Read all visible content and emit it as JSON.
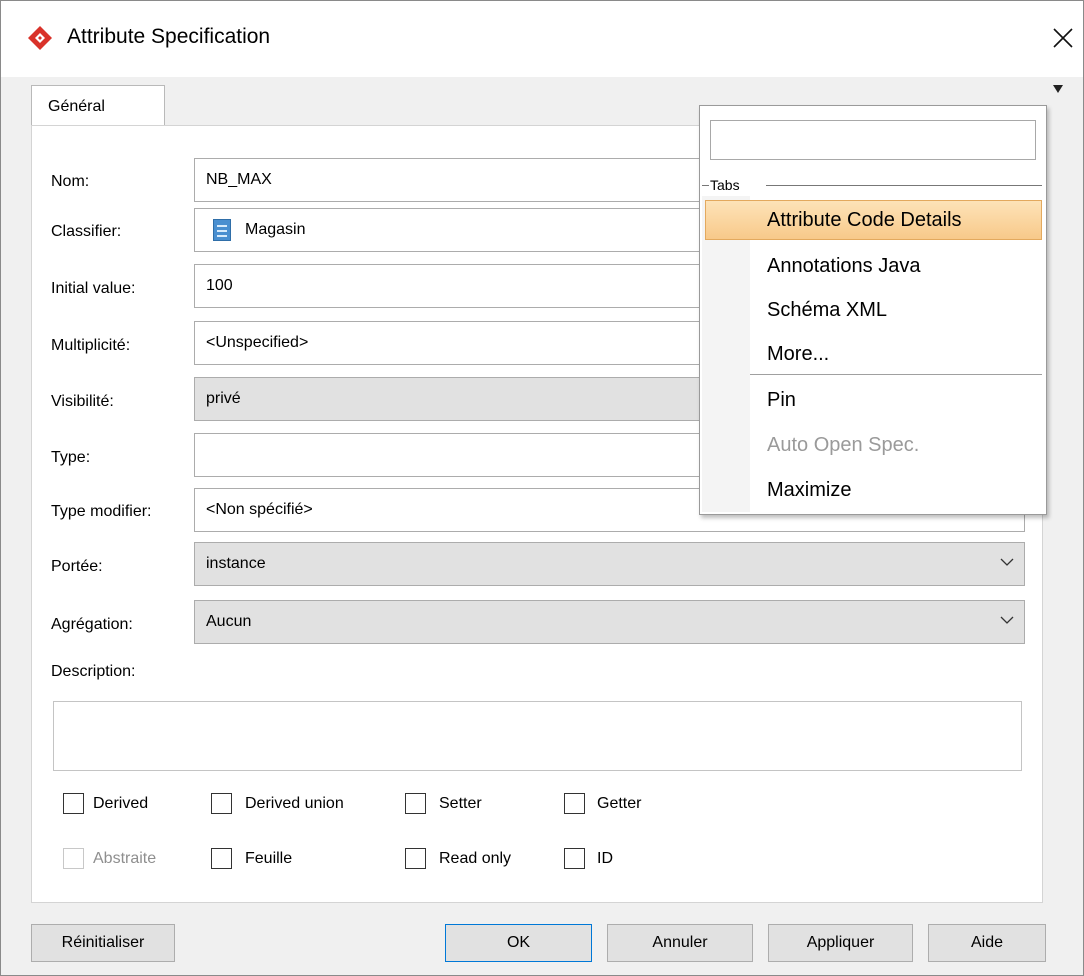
{
  "window": {
    "title": "Attribute Specification"
  },
  "tabs": [
    {
      "label": "Général"
    }
  ],
  "fields": {
    "name": {
      "label": "Nom:",
      "value": "NB_MAX"
    },
    "classifier": {
      "label": "Classifier:",
      "value": "Magasin"
    },
    "initial_value": {
      "label": "Initial value:",
      "value": "100"
    },
    "multiplicity": {
      "label": "Multiplicité:",
      "value": "<Unspecified>"
    },
    "visibility": {
      "label": "Visibilité:",
      "value": "privé"
    },
    "type": {
      "label": "Type:",
      "value": ""
    },
    "type_modifier": {
      "label": "Type modifier:",
      "value": "<Non spécifié>"
    },
    "scope": {
      "label": "Portée:",
      "value": "instance"
    },
    "aggregation": {
      "label": "Agrégation:",
      "value": "Aucun"
    },
    "description": {
      "label": "Description:",
      "value": ""
    }
  },
  "checkboxes": [
    {
      "label": "Derived",
      "checked": false,
      "enabled": true
    },
    {
      "label": "Derived union",
      "checked": false,
      "enabled": true
    },
    {
      "label": "Setter",
      "checked": false,
      "enabled": true
    },
    {
      "label": "Getter",
      "checked": false,
      "enabled": true
    },
    {
      "label": "Abstraite",
      "checked": false,
      "enabled": false
    },
    {
      "label": "Feuille",
      "checked": false,
      "enabled": true
    },
    {
      "label": "Read only",
      "checked": false,
      "enabled": true
    },
    {
      "label": "ID",
      "checked": false,
      "enabled": true
    }
  ],
  "buttons": {
    "reset": "Réinitialiser",
    "ok": "OK",
    "cancel": "Annuler",
    "apply": "Appliquer",
    "help": "Aide"
  },
  "popup_menu": {
    "search_value": "",
    "section_title": "Tabs",
    "items": [
      {
        "label": "Attribute Code Details",
        "highlighted": true,
        "enabled": true
      },
      {
        "label": "Annotations Java",
        "enabled": true
      },
      {
        "label": "Schéma XML",
        "enabled": true
      },
      {
        "label": "More...",
        "enabled": true
      },
      {
        "label": "Pin",
        "enabled": true
      },
      {
        "label": "Auto Open Spec.",
        "enabled": false
      },
      {
        "label": "Maximize",
        "enabled": true
      }
    ]
  },
  "colors": {
    "app_icon": "#d9322a",
    "highlight": "#f8c98a",
    "default_button_border": "#0078d7"
  }
}
